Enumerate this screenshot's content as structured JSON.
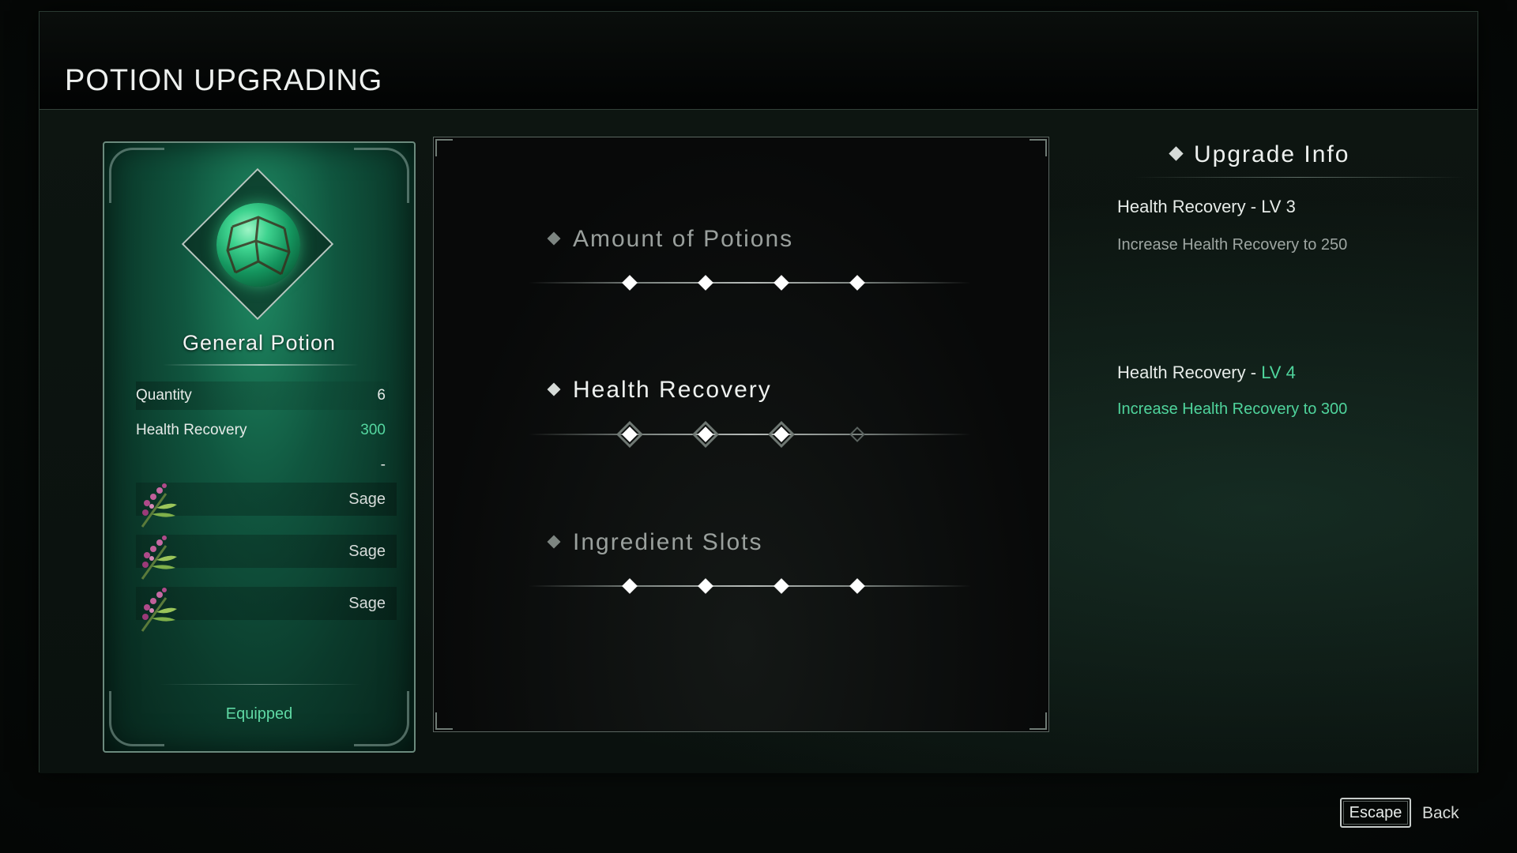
{
  "header": {
    "title": "POTION UPGRADING"
  },
  "potion_card": {
    "name": "General Potion",
    "stats": [
      {
        "label": "Quantity",
        "value": "6"
      },
      {
        "label": "Health Recovery",
        "value": "300"
      },
      {
        "label": "",
        "value": "-"
      }
    ],
    "ingredients": [
      "Sage",
      "Sage",
      "Sage"
    ],
    "status": "Equipped"
  },
  "upgrades": [
    {
      "title": "Amount of Potions",
      "active": false,
      "levels_filled": 4,
      "levels_total": 4
    },
    {
      "title": "Health Recovery",
      "active": true,
      "levels_filled": 3,
      "levels_total": 4
    },
    {
      "title": "Ingredient Slots",
      "active": false,
      "levels_filled": 4,
      "levels_total": 4
    }
  ],
  "info": {
    "title": "Upgrade Info",
    "current": {
      "label": "Health Recovery - ",
      "level": "LV 3",
      "desc": "Increase Health Recovery to 250"
    },
    "next": {
      "label": "Health Recovery - ",
      "level": "LV 4",
      "desc": "Increase Health Recovery to 300"
    }
  },
  "footer": {
    "key": "Escape",
    "action": "Back"
  },
  "colors": {
    "accent_green": "#4fd49c",
    "potion_green": "#1f8a63"
  }
}
